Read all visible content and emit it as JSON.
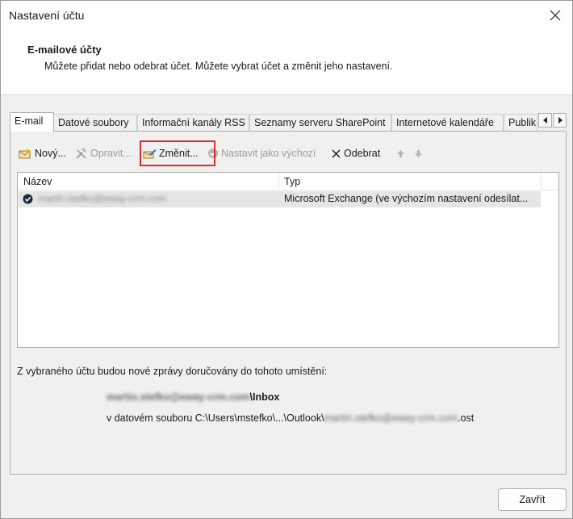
{
  "window": {
    "title": "Nastavení účtu",
    "close_icon": "close-icon"
  },
  "header": {
    "title": "E-mailové účty",
    "description": "Můžete přidat nebo odebrat účet. Můžete vybrat účet a změnit jeho nastavení."
  },
  "tabs": [
    {
      "label": "E-mail",
      "active": true
    },
    {
      "label": "Datové soubory",
      "active": false
    },
    {
      "label": "Informační kanály RSS",
      "active": false
    },
    {
      "label": "Seznamy serveru SharePoint",
      "active": false
    },
    {
      "label": "Internetové kalendáře",
      "active": false
    },
    {
      "label": "Publik",
      "active": false
    }
  ],
  "toolbar": {
    "new_label": "Nový...",
    "repair_label": "Opravit...",
    "change_label": "Změnit...",
    "set_default_label": "Nastavit jako výchozí",
    "remove_label": "Odebrat",
    "highlight_color": "#d32f2f"
  },
  "accounts_list": {
    "columns": [
      "Název",
      "Typ"
    ],
    "rows": [
      {
        "name": "martin.stefko@eway-crm.com",
        "type": "Microsoft Exchange (ve výchozím nastavení odesílat..."
      }
    ]
  },
  "delivery": {
    "label": "Z vybraného účtu budou nové zprávy doručovány do tohoto umístění:",
    "email": "martin.stefko@eway-crm.com",
    "folder_suffix": "\\Inbox",
    "path_prefix": "v datovém souboru C:\\Users\\mstefko\\...\\Outlook\\",
    "path_email": "martin.stefko@eway-crm.com",
    "path_suffix": ".ost"
  },
  "footer": {
    "close_label": "Zavřít"
  }
}
